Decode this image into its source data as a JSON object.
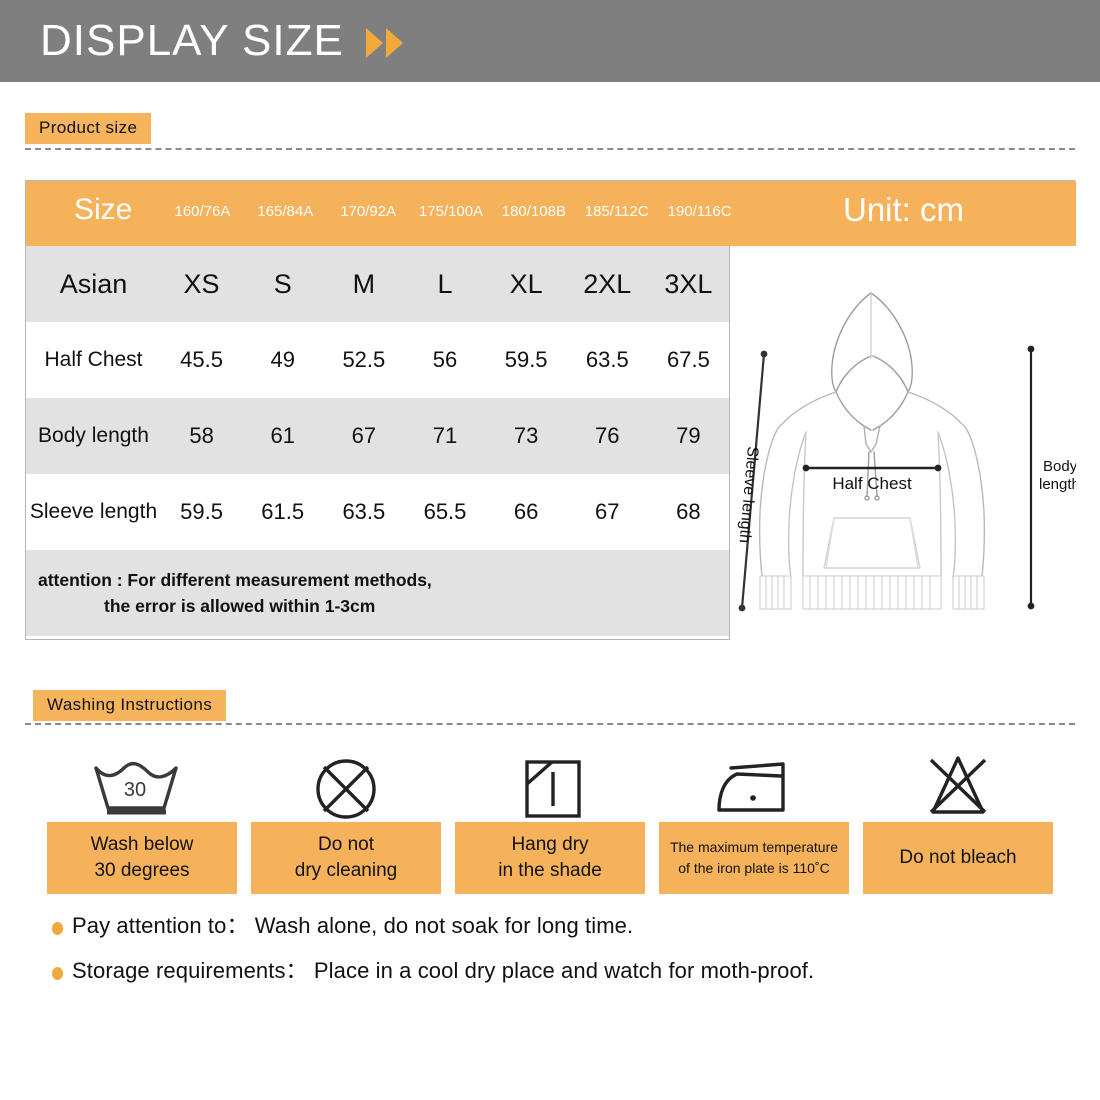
{
  "banner": {
    "title": "DISPLAY SIZE",
    "chevron_color": "#f4a93c",
    "bg_color": "#7f7f7f"
  },
  "sections": {
    "product_size_tab": "Product size",
    "washing_tab": "Washing Instructions"
  },
  "size_table": {
    "unit_label": "Unit: cm",
    "size_header_label": "Size",
    "size_codes": [
      "160/76A",
      "165/84A",
      "170/92A",
      "175/100A",
      "180/108B",
      "185/112C",
      "190/116C"
    ],
    "row_header_label": "Asian",
    "asian_sizes": [
      "XS",
      "S",
      "M",
      "L",
      "XL",
      "2XL",
      "3XL"
    ],
    "rows": [
      {
        "label": "Half  Chest",
        "values": [
          "45.5",
          "49",
          "52.5",
          "56",
          "59.5",
          "63.5",
          "67.5"
        ]
      },
      {
        "label": "Body  length",
        "values": [
          "58",
          "61",
          "67",
          "71",
          "73",
          "76",
          "79"
        ]
      },
      {
        "label": "Sleeve  length",
        "values": [
          "59.5",
          "61.5",
          "63.5",
          "65.5",
          "66",
          "67",
          "68"
        ]
      }
    ],
    "attention_line1": "attention : For different measurement methods,",
    "attention_line2": "the error is allowed within 1-3cm",
    "accent_color": "#f5b25a",
    "stripe_color": "#e2e2e2"
  },
  "diagram": {
    "half_chest_label": "Half  Chest",
    "sleeve_length_label": "Sleeve length",
    "body_length_label_line1": "Body",
    "body_length_label_line2": "length"
  },
  "washing": {
    "items": [
      {
        "icon": "wash-tub-30-icon",
        "temp": "30",
        "label_line1": "Wash below",
        "label_line2": "30 degrees",
        "small": false
      },
      {
        "icon": "no-dry-clean-icon",
        "label_line1": "Do not",
        "label_line2": "dry cleaning",
        "small": false
      },
      {
        "icon": "hang-dry-shade-icon",
        "label_line1": "Hang dry",
        "label_line2": "in the shade",
        "small": false
      },
      {
        "icon": "iron-one-dot-icon",
        "label_line1": "The maximum temperature",
        "label_line2": "of the iron plate is 110˚C",
        "small": true
      },
      {
        "icon": "no-bleach-icon",
        "label_line1": "Do not bleach",
        "label_line2": "",
        "small": false
      }
    ]
  },
  "notes": [
    "Pay attention to：  Wash alone, do not soak for long time.",
    "Storage requirements：  Place in a cool dry place and watch for moth-proof."
  ]
}
